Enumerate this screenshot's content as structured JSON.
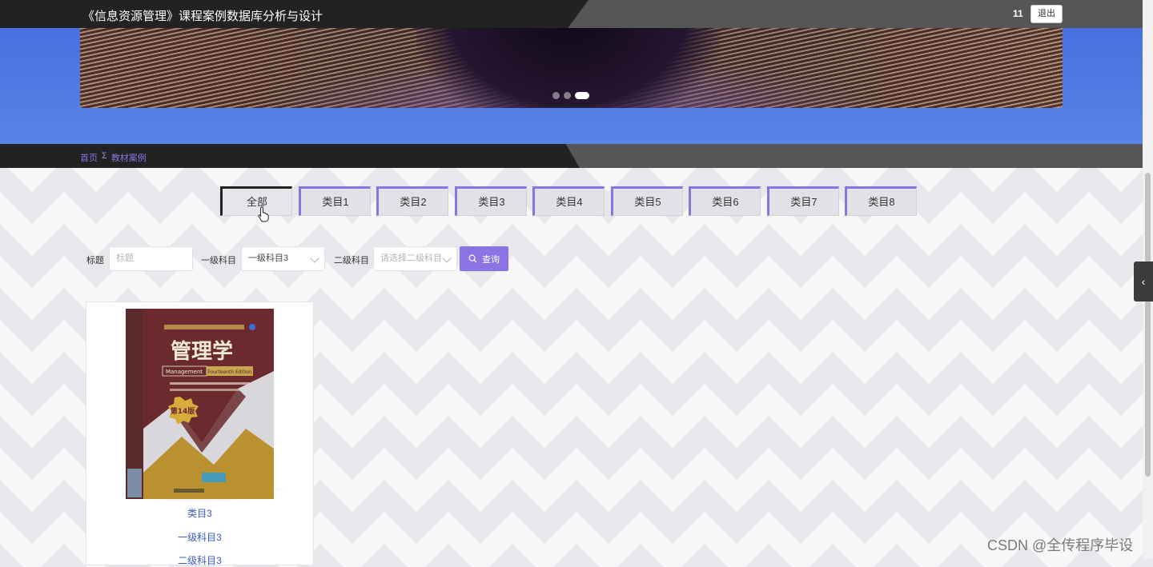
{
  "header": {
    "site_title": "《信息资源管理》课程案例数据库分析与设计",
    "user_name": "11",
    "logout_label": "退出"
  },
  "breadcrumb": {
    "home": "首页",
    "separator": "Σ",
    "current": "教材案例"
  },
  "category_tabs": [
    {
      "label": "全部",
      "active": true
    },
    {
      "label": "类目1"
    },
    {
      "label": "类目2"
    },
    {
      "label": "类目3"
    },
    {
      "label": "类目4"
    },
    {
      "label": "类目5"
    },
    {
      "label": "类目6"
    },
    {
      "label": "类目7"
    },
    {
      "label": "类目8"
    }
  ],
  "search": {
    "title_label": "标题",
    "title_placeholder": "标题",
    "level1_label": "一级科目",
    "level1_value": "一级科目3",
    "level2_label": "二级科目",
    "level2_placeholder": "请选择二级科目",
    "query_label": "查询"
  },
  "card": {
    "category": "类目3",
    "level1": "一级科目3",
    "level2": "二级科目3",
    "book": {
      "title": "管理学",
      "subtitle_en": "Management",
      "edition_en": "Fourteenth Edition",
      "edition_badge": "第14版"
    }
  },
  "side_toggle_label": "‹",
  "watermark": "CSDN @全传程序毕设",
  "colors": {
    "accent": "#8a74e4",
    "banner_blue": "#4a6fe0",
    "bar_dark": "#222222",
    "link_blue": "#3c5bbd"
  }
}
